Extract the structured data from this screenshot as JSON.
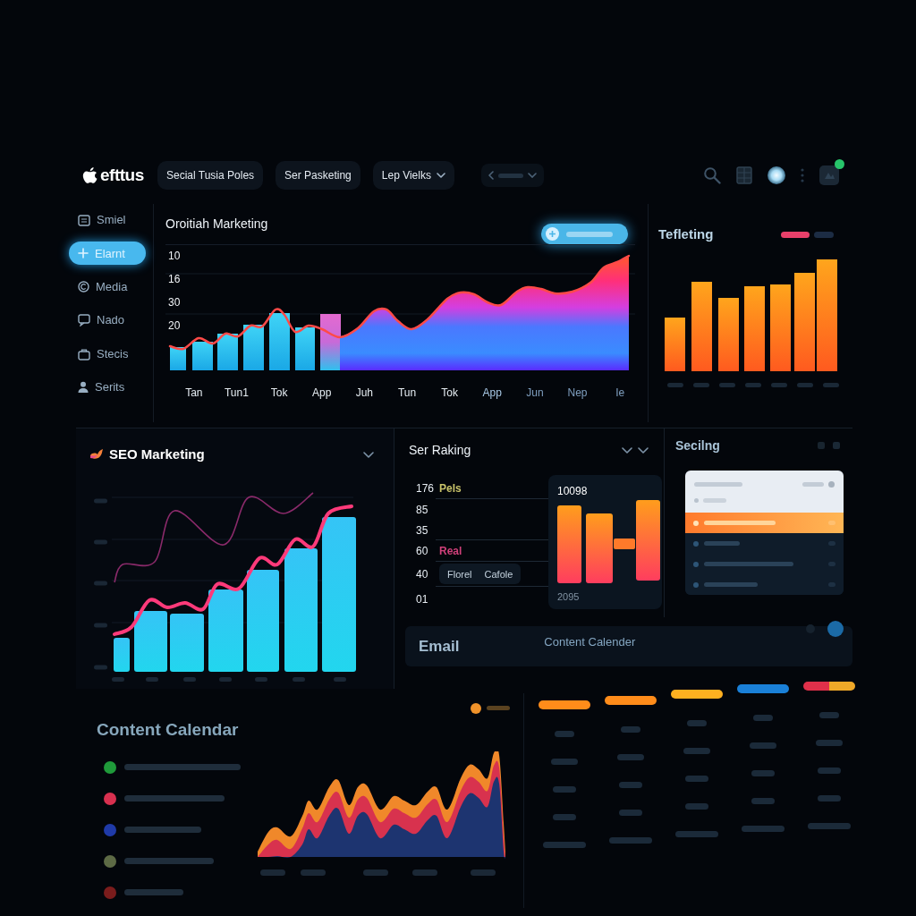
{
  "header": {
    "logo": "efttus",
    "tabs": [
      {
        "label": "Secial Tusia Poles",
        "kind": "tab",
        "selected": false
      },
      {
        "label": "Ser Pasketing",
        "kind": "tab",
        "selected": false
      },
      {
        "label": "Lep Vielks",
        "kind": "dropdown",
        "selected": false
      }
    ]
  },
  "sidebar": {
    "items": [
      {
        "label": "Smiel",
        "selected": false
      },
      {
        "label": "Elarnt",
        "selected": true
      },
      {
        "label": "Media",
        "selected": false
      },
      {
        "label": "Nado",
        "selected": false
      },
      {
        "label": "Stecis",
        "selected": false
      },
      {
        "label": "Serits",
        "selected": false
      }
    ]
  },
  "overview_panel": {
    "title": "Oroitiah Marketing",
    "y_labels": [
      "10",
      "16",
      "30",
      "20"
    ],
    "x_labels": [
      "Tan",
      "Tun1",
      "Tok",
      "App",
      "Juh",
      "Tun",
      "Tok",
      "App",
      "Jun",
      "Nep",
      "Ie"
    ]
  },
  "side_panel": {
    "title": "Tefleting",
    "legend": [
      {
        "color": "#e8406a"
      },
      {
        "color": "#1c2c44"
      }
    ]
  },
  "seo_panel": {
    "title": "SEO Marketing"
  },
  "ranking_panel": {
    "title": "Ser Raking",
    "y_labels": [
      "176",
      "85",
      "35",
      "60",
      "40",
      "01"
    ],
    "series_labels": [
      {
        "label": "Pels",
        "color": "#c9c36a"
      },
      {
        "label": "Real",
        "color": "#d0407a"
      }
    ],
    "buttons": [
      "Florel",
      "Cafole"
    ],
    "card": {
      "value": "10098",
      "caption": "2095"
    }
  },
  "list_panel": {
    "title": "Secilng",
    "rows": [
      {
        "selected": true
      },
      {
        "selected": false
      },
      {
        "selected": false
      },
      {
        "selected": false
      }
    ]
  },
  "email_bar": {
    "title": "Email",
    "subtitle": "Content Calender"
  },
  "calendar_panel": {
    "title": "Content Calendar",
    "chart_legend": {
      "color": "#f0922a"
    },
    "legend": [
      {
        "color": "#1f9a3a"
      },
      {
        "color": "#d8304f"
      },
      {
        "color": "#1f3aa8"
      },
      {
        "color": "#5d6a45"
      },
      {
        "color": "#7a1c1c"
      }
    ]
  },
  "calendar_table": {
    "columns": [
      {
        "segments": [
          {
            "color": "#ff8c1a"
          }
        ]
      },
      {
        "segments": [
          {
            "color": "#ff8c1a"
          }
        ]
      },
      {
        "segments": [
          {
            "color": "#ffb020"
          }
        ]
      },
      {
        "segments": [
          {
            "color": "#1a80d8"
          }
        ]
      },
      {
        "segments": [
          {
            "color": "#e0304a"
          },
          {
            "color": "#f0a828"
          }
        ]
      }
    ]
  }
}
